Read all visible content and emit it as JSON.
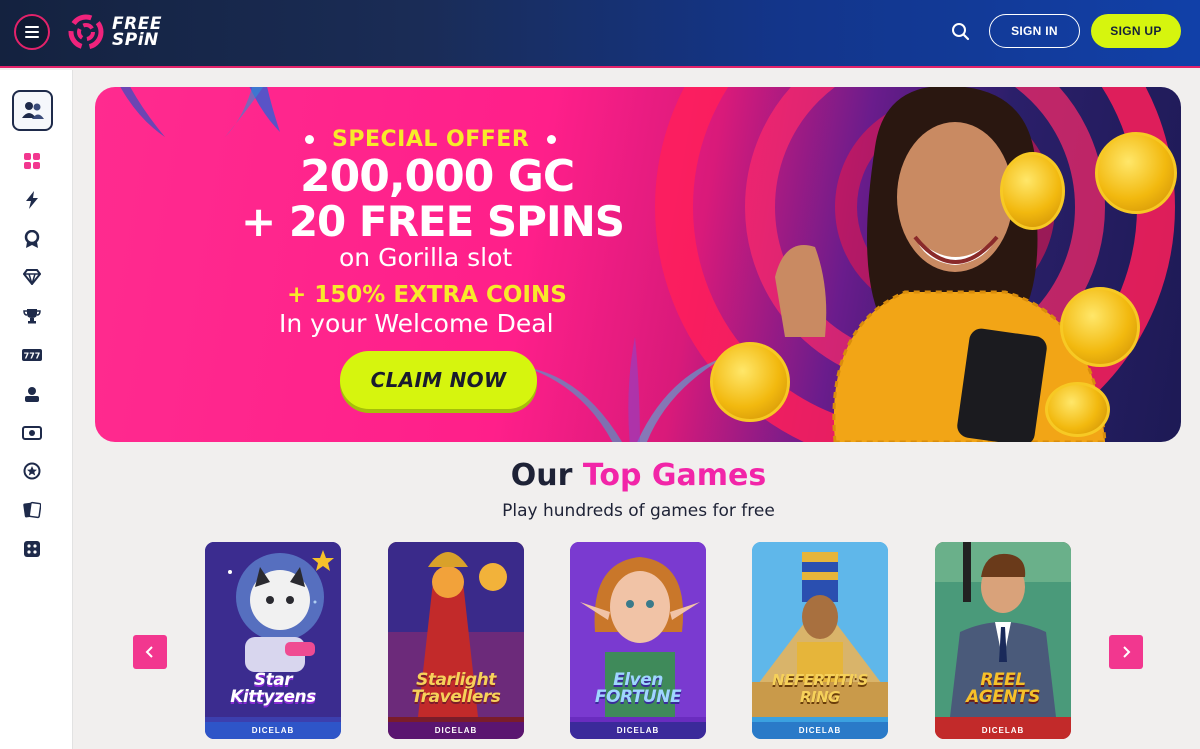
{
  "header": {
    "logo_line1": "FREE",
    "logo_line2": "SPiN",
    "signin_label": "SIGN IN",
    "signup_label": "SIGN UP"
  },
  "colors": {
    "accent_pink": "#f2378f",
    "lime": "#d6f50e",
    "header_navy": "#14223f",
    "title_magenta": "#f225a8"
  },
  "sidebar": {
    "items": [
      {
        "icon": "grid-icon"
      },
      {
        "icon": "lightning-icon"
      },
      {
        "icon": "badge-icon"
      },
      {
        "icon": "diamond-icon"
      },
      {
        "icon": "trophy-icon"
      },
      {
        "icon": "slot-777-icon"
      },
      {
        "icon": "user-icon"
      },
      {
        "icon": "cash-icon"
      },
      {
        "icon": "star-circle-icon"
      },
      {
        "icon": "cards-icon"
      },
      {
        "icon": "dice-icon"
      }
    ]
  },
  "banner": {
    "special_offer": "SPECIAL OFFER",
    "headline1": "200,000 GC",
    "headline2": "+ 20 FREE SPINS",
    "subline1": "on Gorilla slot",
    "subline2": "+ 150% EXTRA COINS",
    "subline3": "In your Welcome Deal",
    "cta_label": "CLAIM NOW"
  },
  "top_games": {
    "title_prefix": "Our",
    "title_accent": "Top Games",
    "subtitle": "Play hundreds of games for free",
    "games": [
      {
        "name_line1": "Star",
        "name_line2": "Kittyzens",
        "provider": "DICELAB"
      },
      {
        "name_line1": "Starlight",
        "name_line2": "Travellers",
        "provider": "DICELAB"
      },
      {
        "name_line1": "Elven",
        "name_line2": "FORTUNE",
        "provider": "DICELAB"
      },
      {
        "name_line1": "NEFERTITI'S",
        "name_line2": "RING",
        "provider": "DICELAB"
      },
      {
        "name_line1": "REEL",
        "name_line2": "AGENTS",
        "provider": "DICELAB"
      }
    ]
  }
}
